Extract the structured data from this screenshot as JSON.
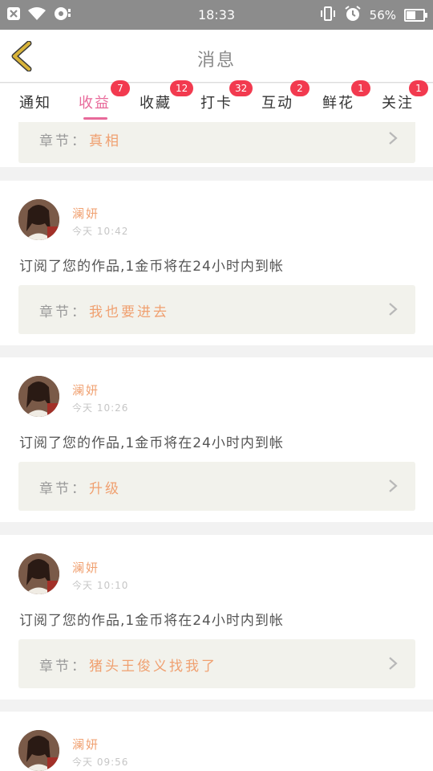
{
  "status_bar": {
    "time": "18:33",
    "battery_percent": "56%",
    "battery_level": 0.56,
    "icons": [
      "close-notification-icon",
      "wifi-icon",
      "sync-icon",
      "vibrate-icon",
      "alarm-icon",
      "battery-icon"
    ]
  },
  "header": {
    "title": "消息",
    "back_icon": "chevron-left-icon"
  },
  "tabs": [
    {
      "label": "通知",
      "badge": ""
    },
    {
      "label": "收益",
      "badge": "7",
      "active": true
    },
    {
      "label": "收藏",
      "badge": "12"
    },
    {
      "label": "打卡",
      "badge": "32"
    },
    {
      "label": "互动",
      "badge": "2"
    },
    {
      "label": "鲜花",
      "badge": "1"
    },
    {
      "label": "关注",
      "badge": "1"
    }
  ],
  "colors": {
    "accent": "#e8699a",
    "badge": "#f23a4f",
    "highlight": "#f0a070",
    "back_arrow": "#d9b43a"
  },
  "partial_card": {
    "chapter_label": "章节：",
    "chapter_name": "真相"
  },
  "messages": [
    {
      "username": "澜妍",
      "time": "今天 10:42",
      "text": "订阅了您的作品,1金币将在24小时内到帐",
      "chapter_label": "章节：",
      "chapter_name": "我也要进去"
    },
    {
      "username": "澜妍",
      "time": "今天 10:26",
      "text": "订阅了您的作品,1金币将在24小时内到帐",
      "chapter_label": "章节：",
      "chapter_name": "升级"
    },
    {
      "username": "澜妍",
      "time": "今天 10:10",
      "text": "订阅了您的作品,1金币将在24小时内到帐",
      "chapter_label": "章节：",
      "chapter_name": "猪头王俊义找我了"
    },
    {
      "username": "澜妍",
      "time": "今天 09:56"
    }
  ]
}
